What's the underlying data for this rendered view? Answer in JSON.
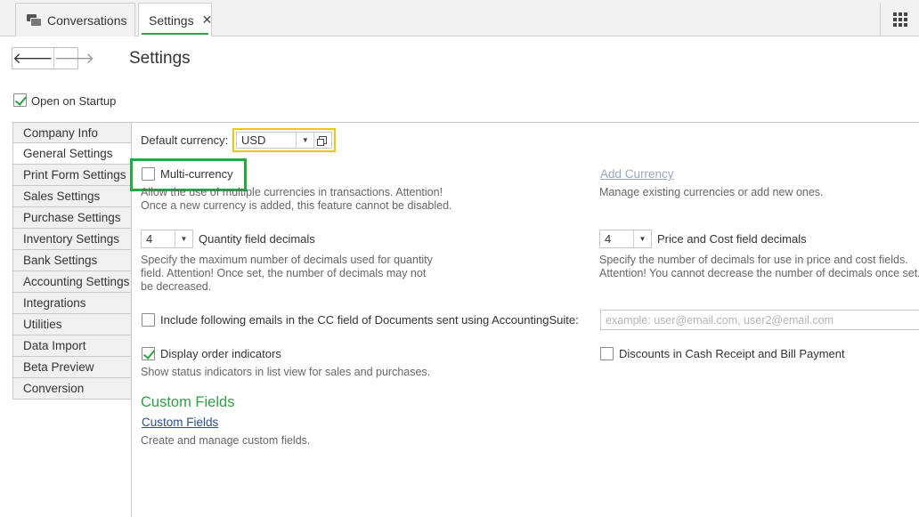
{
  "tabs": [
    {
      "label": "Conversations",
      "active": false
    },
    {
      "label": "Settings",
      "active": true,
      "close": "✕"
    }
  ],
  "header": {
    "title": "Settings"
  },
  "nav": {
    "back": "🡐",
    "forward": "🡒"
  },
  "open_on_startup": {
    "label": "Open on Startup",
    "checked": true
  },
  "sidebar": {
    "items": [
      {
        "label": "Company Info"
      },
      {
        "label": "General Settings",
        "active": true
      },
      {
        "label": "Print Form Settings"
      },
      {
        "label": "Sales Settings"
      },
      {
        "label": "Purchase Settings"
      },
      {
        "label": "Inventory Settings"
      },
      {
        "label": "Bank Settings"
      },
      {
        "label": "Accounting Settings"
      },
      {
        "label": "Integrations"
      },
      {
        "label": "Utilities"
      },
      {
        "label": "Data Import"
      },
      {
        "label": "Beta Preview"
      },
      {
        "label": "Conversion"
      }
    ]
  },
  "general": {
    "default_currency_label": "Default currency:",
    "default_currency_value": "USD",
    "multi_currency": {
      "label": "Multi-currency",
      "checked": false,
      "desc1": "Allow the use of multiple currencies in transactions.   Attention!",
      "desc2": "Once a new currency is added, this feature cannot be disabled."
    },
    "add_currency": {
      "link": "Add Currency",
      "desc": "Manage existing currencies or add new ones."
    },
    "quantity_decimals": {
      "value": "4",
      "label": "Quantity field decimals",
      "desc1": "Specify the maximum number of decimals used for quantity",
      "desc2": "field.  Attention!  Once set, the number of decimals may not",
      "desc3": "be decreased."
    },
    "price_decimals": {
      "value": "4",
      "label": "Price and Cost field decimals",
      "desc1": "Specify the number of decimals for use in price and cost fields.",
      "desc2": "Attention!  You cannot decrease the number of decimals once set."
    },
    "cc_emails": {
      "label": "Include following emails in the CC field of Documents sent using AccountingSuite:",
      "checked": false,
      "placeholder": "example: user@email.com, user2@email.com"
    },
    "order_indicators": {
      "label": "Display order indicators",
      "checked": true,
      "desc": "Show status indicators in list view for sales and purchases."
    },
    "discounts": {
      "label": "Discounts in Cash Receipt and Bill Payment",
      "checked": false
    },
    "custom_fields": {
      "title": "Custom Fields",
      "link": "Custom Fields",
      "desc": "Create and manage custom fields."
    }
  },
  "colors": {
    "accent_green": "#2ea043",
    "highlight_yellow": "#f1c40f",
    "highlight_green": "#27a844",
    "link_blue": "#2b4f8c"
  }
}
